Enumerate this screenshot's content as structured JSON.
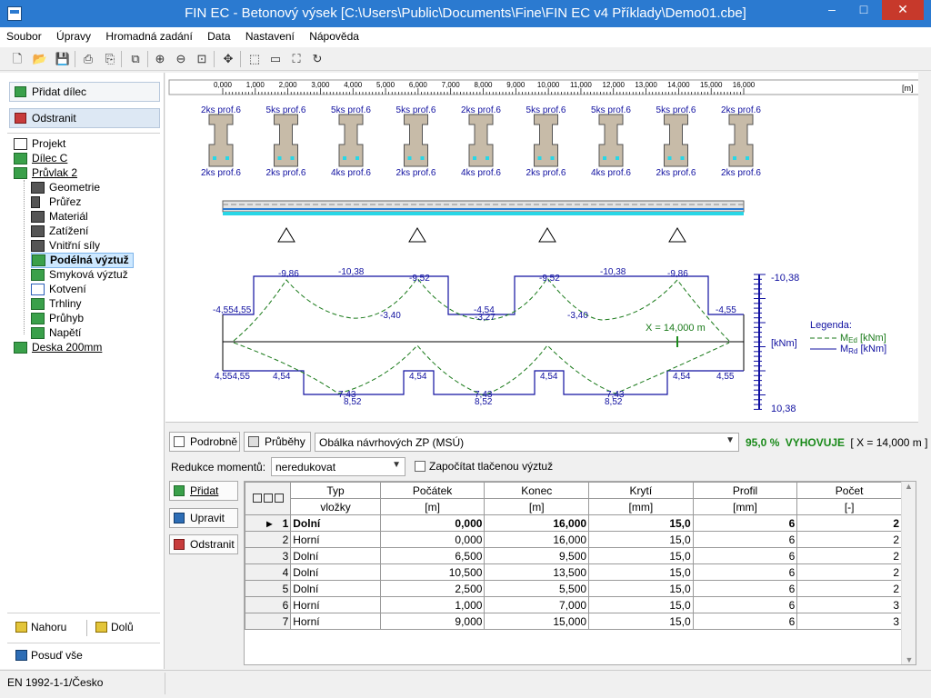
{
  "window": {
    "title": "FIN EC - Betonový výsek [C:\\Users\\Public\\Documents\\Fine\\FIN EC v4 Příklady\\Demo01.cbe]",
    "minimize": "–",
    "maximize": "□",
    "close": "✕"
  },
  "menu": [
    "Soubor",
    "Úpravy",
    "Hromadná zadání",
    "Data",
    "Nastavení",
    "Nápověda"
  ],
  "left": {
    "add_part": "Přidat dílec",
    "remove": "Odstranit",
    "tree": [
      {
        "label": "Projekt",
        "icon": "document-icon"
      },
      {
        "label": "Dílec C",
        "icon": "part-icon"
      },
      {
        "label": "Průvlak 2",
        "icon": "part-icon"
      },
      {
        "label": "Geometrie",
        "icon": "geometry-icon"
      },
      {
        "label": "Průřez",
        "icon": "cross-section-icon"
      },
      {
        "label": "Materiál",
        "icon": "material-icon"
      },
      {
        "label": "Zatížení",
        "icon": "load-icon"
      },
      {
        "label": "Vnitřní síly",
        "icon": "internal-forces-icon"
      },
      {
        "label": "Podélná výztuž",
        "icon": "longitudinal-reinforcement-icon"
      },
      {
        "label": "Smyková výztuž",
        "icon": "shear-reinforcement-icon"
      },
      {
        "label": "Kotvení",
        "icon": "anchorage-icon"
      },
      {
        "label": "Trhliny",
        "icon": "cracks-icon"
      },
      {
        "label": "Průhyb",
        "icon": "deflection-icon"
      },
      {
        "label": "Napětí",
        "icon": "stress-icon"
      },
      {
        "label": "Deska 200mm",
        "icon": "part-icon"
      }
    ],
    "up": "Nahoru",
    "down": "Dolů",
    "check_all": "Posuď vše"
  },
  "status": "EN 1992-1-1/Česko",
  "drawing": {
    "ruler_ticks": [
      "0,000",
      "1,000",
      "2,000",
      "3,000",
      "4,000",
      "5,000",
      "6,000",
      "7,000",
      "8,000",
      "9,000",
      "10,000",
      "11,000",
      "12,000",
      "13,000",
      "14,000",
      "15,000",
      "16,000"
    ],
    "ruler_unit": "[m]",
    "sections": [
      {
        "top": "2ks prof.6",
        "bottom": "2ks prof.6"
      },
      {
        "top": "5ks prof.6",
        "bottom": "2ks prof.6"
      },
      {
        "top": "5ks prof.6",
        "bottom": "4ks prof.6"
      },
      {
        "top": "5ks prof.6",
        "bottom": "2ks prof.6"
      },
      {
        "top": "2ks prof.6",
        "bottom": "4ks prof.6"
      },
      {
        "top": "5ks prof.6",
        "bottom": "2ks prof.6"
      },
      {
        "top": "5ks prof.6",
        "bottom": "4ks prof.6"
      },
      {
        "top": "5ks prof.6",
        "bottom": "2ks prof.6"
      },
      {
        "top": "2ks prof.6",
        "bottom": "2ks prof.6"
      }
    ],
    "moment_labels_top": [
      "-9,86",
      "-10,38",
      "-9,52",
      "-9,52",
      "-10,38",
      "-9,86",
      "-4,554,55",
      "-3,40",
      "-4,54",
      "-3,27",
      "-3,40",
      "-4,55"
    ],
    "moment_labels_bottom": [
      "4,554,55",
      "4,54",
      "7,43",
      "8,52",
      "4,54",
      "7,43",
      "8,52",
      "4,54",
      "7,43",
      "8,52",
      "4,54",
      "4,55"
    ],
    "x_marker": "X = 14,000 m",
    "scale_top": "-10,38",
    "scale_unit": "[kNm]",
    "scale_bottom": "10,38",
    "legend_title": "Legenda:",
    "legend_med": "M",
    "legend_med_sub": "Ed",
    "legend_med_unit": "[kNm]",
    "legend_mrd": "M",
    "legend_mrd_sub": "Rd",
    "legend_mrd_unit": "[kNm]"
  },
  "lower": {
    "details_btn": "Podrobně",
    "diagrams_btn": "Průběhy",
    "envelope_select": "Obálka návrhových ZP (MSÚ)",
    "result_percent": "95,0 %",
    "result_status": "VYHOVUJE",
    "result_x": "[ X = 14,000 m ]",
    "reduction_label": "Redukce momentů:",
    "reduction_value": "neredukovat",
    "compression_checkbox": "Započítat tlačenou výztuž",
    "add_btn": "Přidat",
    "edit_btn": "Upravit",
    "remove_btn": "Odstranit",
    "columns": [
      {
        "h1": "Typ",
        "h2": "vložky"
      },
      {
        "h1": "Počátek",
        "h2": "[m]"
      },
      {
        "h1": "Konec",
        "h2": "[m]"
      },
      {
        "h1": "Krytí",
        "h2": "[mm]"
      },
      {
        "h1": "Profil",
        "h2": "[mm]"
      },
      {
        "h1": "Počet",
        "h2": "[-]"
      }
    ],
    "rows": [
      {
        "n": "1",
        "type": "Dolní",
        "start": "0,000",
        "end": "16,000",
        "cover": "15,0",
        "profile": "6",
        "count": "2"
      },
      {
        "n": "2",
        "type": "Horní",
        "start": "0,000",
        "end": "16,000",
        "cover": "15,0",
        "profile": "6",
        "count": "2"
      },
      {
        "n": "3",
        "type": "Dolní",
        "start": "6,500",
        "end": "9,500",
        "cover": "15,0",
        "profile": "6",
        "count": "2"
      },
      {
        "n": "4",
        "type": "Dolní",
        "start": "10,500",
        "end": "13,500",
        "cover": "15,0",
        "profile": "6",
        "count": "2"
      },
      {
        "n": "5",
        "type": "Dolní",
        "start": "2,500",
        "end": "5,500",
        "cover": "15,0",
        "profile": "6",
        "count": "2"
      },
      {
        "n": "6",
        "type": "Horní",
        "start": "1,000",
        "end": "7,000",
        "cover": "15,0",
        "profile": "6",
        "count": "3"
      },
      {
        "n": "7",
        "type": "Horní",
        "start": "9,000",
        "end": "15,000",
        "cover": "15,0",
        "profile": "6",
        "count": "3"
      }
    ]
  }
}
